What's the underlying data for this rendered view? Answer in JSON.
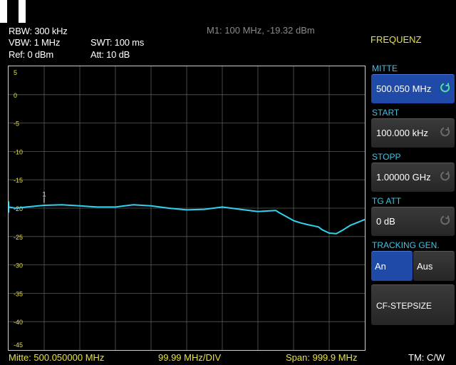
{
  "header": {
    "rbw": "RBW: 300 kHz",
    "vbw": "VBW: 1 MHz",
    "ref": "Ref: 0 dBm",
    "swt": "SWT: 100 ms",
    "att": "Att: 10 dB",
    "marker": "M1: 100 MHz, -19.32 dBm"
  },
  "panel": {
    "title": "FREQUENZ",
    "mitte_label": "MITTE",
    "mitte_value": "500.050 MHz",
    "start_label": "START",
    "start_value": "100.000 kHz",
    "stopp_label": "STOPP",
    "stopp_value": "1.00000 GHz",
    "tgatt_label": "TG ATT",
    "tgatt_value": "0 dB",
    "tracking_label": "TRACKING GEN.",
    "tracking_on": "An",
    "tracking_off": "Aus",
    "cfstep_label": "CF-STEPSIZE"
  },
  "footer": {
    "center": "Mitte: 500.050000 MHz",
    "div": "99.99 MHz/DIV",
    "span": "Span: 999.9 MHz",
    "mode": "TM: C/W"
  },
  "colors": {
    "trace": "#2fd3ee",
    "label": "#3fc4e4",
    "accent": "#e8e33a",
    "active": "#1f4aa8"
  },
  "chart_data": {
    "type": "line",
    "ylim": [
      -45,
      5
    ],
    "xlim_mhz": [
      0.1,
      1000
    ],
    "y_ticks": [
      "5",
      "0",
      "-5",
      "-10",
      "-15",
      "-20",
      "-25",
      "-30",
      "-35",
      "-40",
      "-45"
    ],
    "marker": {
      "label": "1",
      "x": 100,
      "y": -19.32
    },
    "series": [
      {
        "x": [
          0.1,
          20,
          50,
          100,
          150,
          200,
          250,
          300,
          350,
          400,
          450,
          500,
          550,
          600,
          650,
          700,
          750,
          760,
          780,
          800,
          820,
          840,
          870,
          880,
          900,
          920,
          940,
          960,
          980,
          1000
        ],
        "values": [
          -19.8,
          -20.0,
          -19.8,
          -19.5,
          -19.4,
          -19.6,
          -19.8,
          -19.8,
          -19.4,
          -19.6,
          -20.0,
          -20.3,
          -20.2,
          -19.8,
          -20.2,
          -20.6,
          -20.4,
          -20.8,
          -21.5,
          -22.2,
          -22.6,
          -22.9,
          -23.3,
          -23.8,
          -24.4,
          -24.5,
          -23.8,
          -23.0,
          -22.5,
          -22.0
        ]
      }
    ]
  }
}
